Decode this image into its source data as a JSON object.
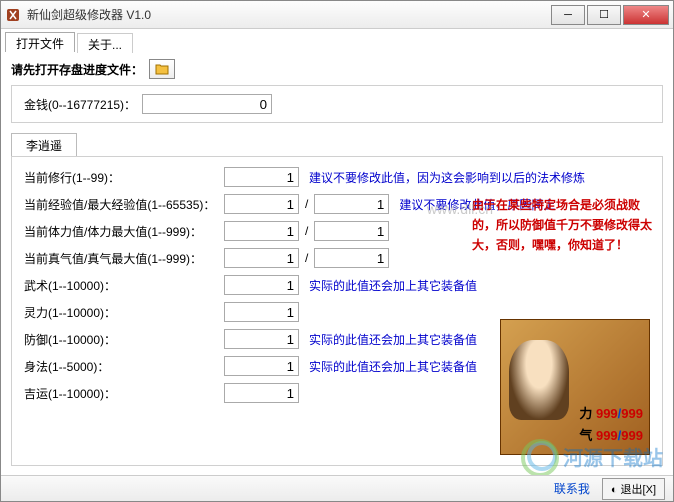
{
  "window": {
    "title": "新仙剑超级修改器 V1.0"
  },
  "menu": {
    "open": "打开文件",
    "about": "关于..."
  },
  "prompt": "请先打开存盘进度文件：",
  "money": {
    "label": "金钱(0--16777215)：",
    "value": "0"
  },
  "charTab": "李逍遥",
  "fields": {
    "xiuxing": {
      "label": "当前修行(1--99)：",
      "v1": "1",
      "note": "建议不要修改此值，因为这会影响到以后的法术修炼"
    },
    "exp": {
      "label": "当前经验值/最大经验值(1--65535)：",
      "v1": "1",
      "v2": "1",
      "note": "建议不要修改此值，原因同上"
    },
    "hp": {
      "label": "当前体力值/体力最大值(1--999)：",
      "v1": "1",
      "v2": "1"
    },
    "mp": {
      "label": "当前真气值/真气最大值(1--999)：",
      "v1": "1",
      "v2": "1"
    },
    "wushu": {
      "label": "武术(1--10000)：",
      "v1": "1",
      "note": "实际的此值还会加上其它装备值"
    },
    "lingli": {
      "label": "灵力(1--10000)：",
      "v1": "1"
    },
    "fangyu": {
      "label": "防御(1--10000)：",
      "v1": "1",
      "note": "实际的此值还会加上其它装备值"
    },
    "shenfa": {
      "label": "身法(1--5000)：",
      "v1": "1",
      "note": "实际的此值还会加上其它装备值"
    },
    "jiyun": {
      "label": "吉运(1--10000)：",
      "v1": "1"
    }
  },
  "warning": "由于在某些特定场合是必须战败的，所以防御值千万不要修改得太大，否则，嘿嘿，你知道了！",
  "portrait": {
    "stat1": {
      "icon": "力",
      "cur": "999",
      "max": "999"
    },
    "stat2": {
      "icon": "气",
      "cur": "999",
      "max": "999"
    }
  },
  "status": {
    "contact": "联系我",
    "exit": "退出[X]"
  },
  "watermark": {
    "site": "河源下载站",
    "url": "www.dll.cn"
  }
}
